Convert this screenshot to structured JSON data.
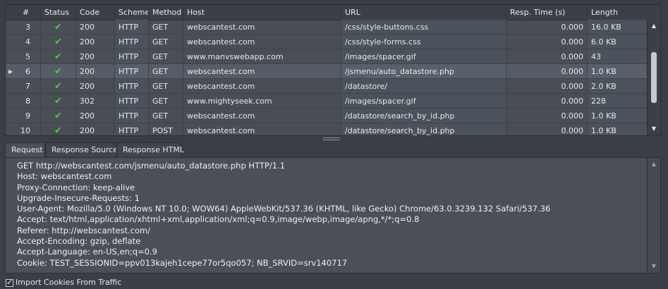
{
  "grid": {
    "columns": [
      "#",
      "Status",
      "Code",
      "Scheme",
      "Method",
      "Host",
      "URL",
      "Resp. Time (s)",
      "Length"
    ],
    "rows": [
      {
        "num": "3",
        "code": "200",
        "scheme": "HTTP",
        "method": "GET",
        "host": "webscantest.com",
        "url": "/css/style-buttons.css",
        "time": "0.000",
        "length": "16.0 KB"
      },
      {
        "num": "4",
        "code": "200",
        "scheme": "HTTP",
        "method": "GET",
        "host": "webscantest.com",
        "url": "/css/style-forms.css",
        "time": "0.000",
        "length": "6.0 KB"
      },
      {
        "num": "5",
        "code": "200",
        "scheme": "HTTP",
        "method": "GET",
        "host": "www.manvswebapp.com",
        "url": "/images/spacer.gif",
        "time": "0.000",
        "length": "43"
      },
      {
        "num": "6",
        "code": "200",
        "scheme": "HTTP",
        "method": "GET",
        "host": "webscantest.com",
        "url": "/jsmenu/auto_datastore.php",
        "time": "0.000",
        "length": "1.0 KB"
      },
      {
        "num": "7",
        "code": "200",
        "scheme": "HTTP",
        "method": "GET",
        "host": "webscantest.com",
        "url": "/datastore/",
        "time": "0.000",
        "length": "2.0 KB"
      },
      {
        "num": "8",
        "code": "302",
        "scheme": "HTTP",
        "method": "GET",
        "host": "www.mightyseek.com",
        "url": "/images/spacer.gif",
        "time": "0.000",
        "length": "228"
      },
      {
        "num": "9",
        "code": "200",
        "scheme": "HTTP",
        "method": "GET",
        "host": "webscantest.com",
        "url": "/datastore/search_by_id.php",
        "time": "0.000",
        "length": "1.0 KB"
      },
      {
        "num": "10",
        "code": "200",
        "scheme": "HTTP",
        "method": "POST",
        "host": "webscantest.com",
        "url": "/datastore/search_by_id.php",
        "time": "0.000",
        "length": "1.0 KB"
      }
    ],
    "selected_index": 3,
    "status_icon": "check-icon",
    "status_glyph": "✔"
  },
  "tabs": [
    "Request",
    "Response Source",
    "Response HTML"
  ],
  "active_tab": "Request",
  "request_lines": [
    "GET http://webscantest.com/jsmenu/auto_datastore.php HTTP/1.1",
    "Host: webscantest.com",
    "Proxy-Connection: keep-alive",
    "Upgrade-Insecure-Requests: 1",
    "User-Agent: Mozilla/5.0 (Windows NT 10.0; WOW64) AppleWebKit/537.36 (KHTML, like Gecko) Chrome/63.0.3239.132 Safari/537.36",
    "Accept: text/html,application/xhtml+xml,application/xml;q=0.9,image/webp,image/apng,*/*;q=0.8",
    "Referer: http://webscantest.com/",
    "Accept-Encoding: gzip, deflate",
    "Accept-Language: en-US,en;q=0.9",
    "Cookie: TEST_SESSIONID=ppv013kajeh1cepe77or5qo057; NB_SRVID=srv140717"
  ],
  "footer": {
    "checkbox_label": "Import Cookies From Traffic",
    "checked": true
  },
  "colors": {
    "background": "#3a3f47",
    "grid": "#484d56",
    "selected_row": "#565c66",
    "status_check": "#4ec94e"
  }
}
